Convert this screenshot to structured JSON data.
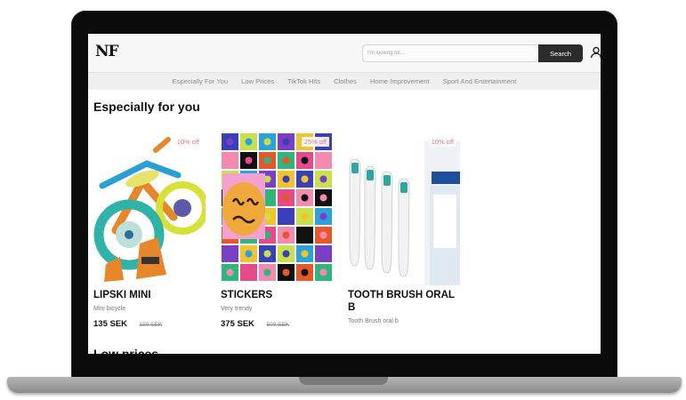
{
  "header": {
    "logo": "NF",
    "search_placeholder": "I'm looking for...",
    "search_button": "Search"
  },
  "nav": {
    "items": [
      {
        "label": "Especially For You"
      },
      {
        "label": "Low Prices"
      },
      {
        "label": "TikTok Hits"
      },
      {
        "label": "Clothes"
      },
      {
        "label": "Home Improvement"
      },
      {
        "label": "Sport And Entertainment"
      }
    ]
  },
  "section": {
    "title": "Especially for you",
    "products": [
      {
        "name": "LIPSKI MINI",
        "desc": "Mini bicycle",
        "price": "135 SEK",
        "old_price": "150 SEK",
        "discount": "10% off",
        "icon": "balance-bike"
      },
      {
        "name": "STICKERS",
        "desc": "Very trendy",
        "price": "375 SEK",
        "old_price": "500 SEK",
        "discount": "25% off",
        "icon": "sticker-collage"
      },
      {
        "name": "TOOTH BRUSH ORAL B",
        "desc": "Tooth Brush oral b",
        "price": "",
        "old_price": "",
        "discount": "10% off",
        "icon": "toothbrush-heads"
      }
    ]
  },
  "next_section": {
    "title": "Low prices"
  },
  "colors": {
    "accent": "#2b2b2b",
    "discount": "#e07a7a"
  }
}
